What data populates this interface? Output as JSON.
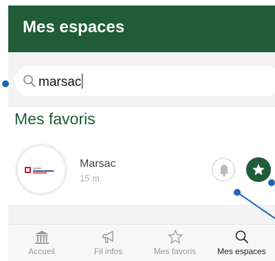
{
  "header": {
    "title": "Mes espaces"
  },
  "search": {
    "value": "marsac",
    "icon": "search-icon"
  },
  "favorites": {
    "title": "Mes favoris",
    "items": [
      {
        "name": "Marsac",
        "distance": "15 m",
        "logo": "marsac-logo"
      }
    ]
  },
  "bottom_nav": {
    "items": [
      {
        "label": "Accueil",
        "icon": "home-icon",
        "active": false
      },
      {
        "label": "Fil infos",
        "icon": "megaphone-icon",
        "active": false
      },
      {
        "label": "Mes favoris",
        "icon": "star-icon",
        "active": false
      },
      {
        "label": "Mes espaces",
        "icon": "search-icon",
        "active": true
      }
    ]
  },
  "colors": {
    "brand": "#1f5c37",
    "annotation": "#1e66b6",
    "inactive": "#999999"
  }
}
